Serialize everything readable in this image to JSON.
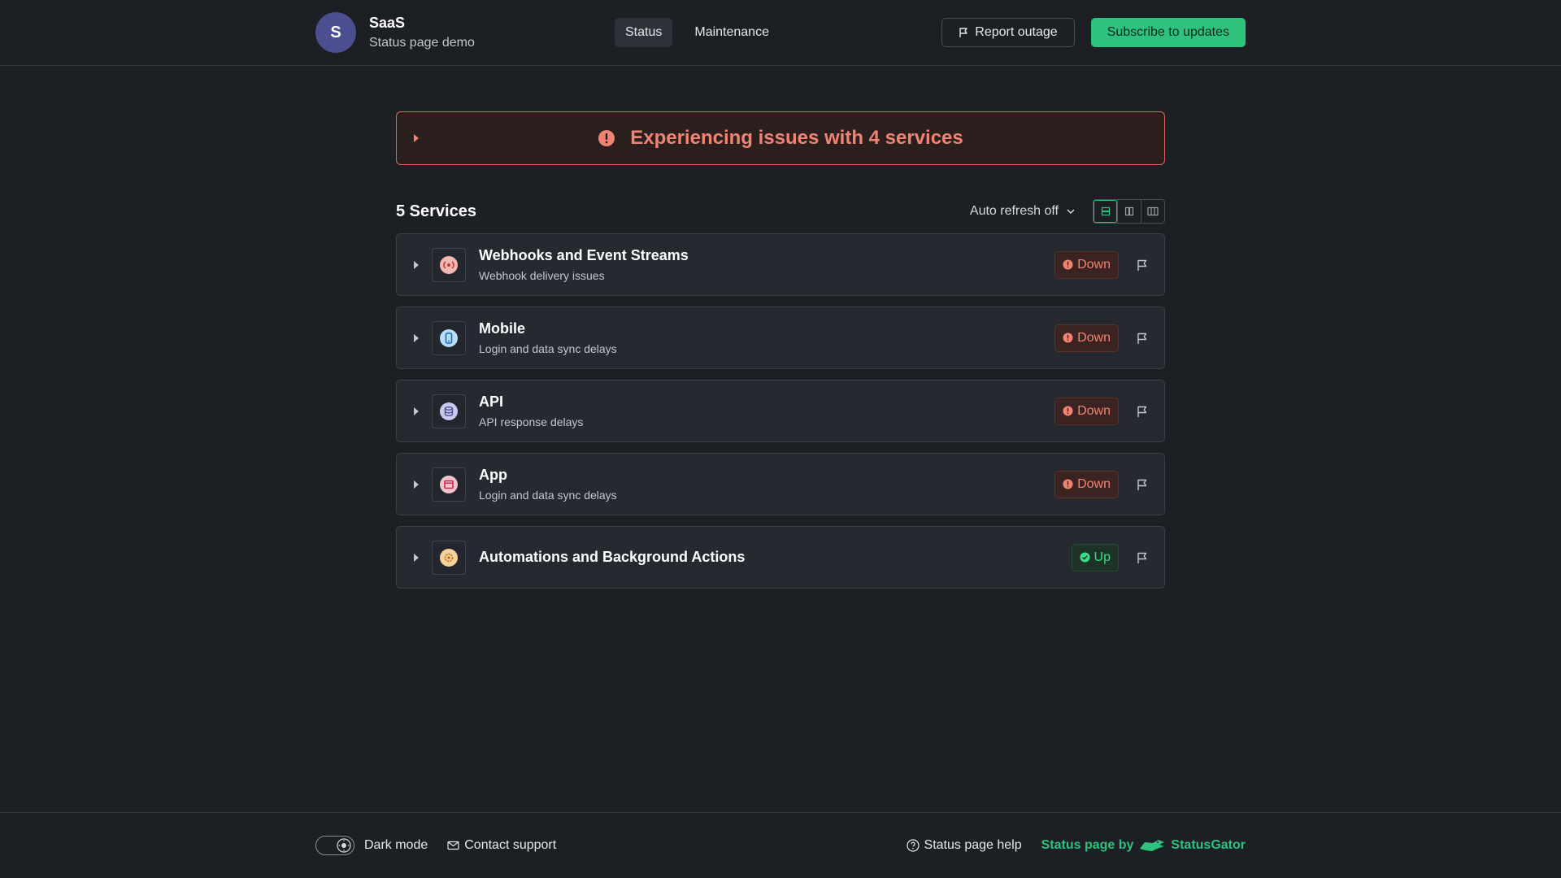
{
  "header": {
    "avatar_letter": "S",
    "org_name": "SaaS",
    "org_sub": "Status page demo",
    "nav": [
      {
        "label": "Status",
        "active": true
      },
      {
        "label": "Maintenance",
        "active": false
      }
    ],
    "report_label": "Report outage",
    "subscribe_label": "Subscribe to updates"
  },
  "banner": {
    "title": "Experiencing issues with 4 services",
    "color": "#f08474"
  },
  "list": {
    "title": "5 Services",
    "refresh_label": "Auto refresh off"
  },
  "services": [
    {
      "name": "Webhooks and Event Streams",
      "desc": "Webhook delivery issues",
      "status": "Down",
      "icon": "broadcast-icon"
    },
    {
      "name": "Mobile",
      "desc": "Login and data sync delays",
      "status": "Down",
      "icon": "phone-icon"
    },
    {
      "name": "API",
      "desc": "API response delays",
      "status": "Down",
      "icon": "database-icon"
    },
    {
      "name": "App",
      "desc": "Login and data sync delays",
      "status": "Down",
      "icon": "window-icon"
    },
    {
      "name": "Automations and Background Actions",
      "desc": "",
      "status": "Up",
      "icon": "gear-icon"
    }
  ],
  "footer": {
    "dark_mode_label": "Dark mode",
    "contact_label": "Contact support",
    "help_label": "Status page help",
    "powered_prefix": "Status page by",
    "powered_brand": "StatusGator"
  },
  "colors": {
    "accent": "#2ec27e",
    "down": "#f08474",
    "up": "#3ddc84"
  }
}
